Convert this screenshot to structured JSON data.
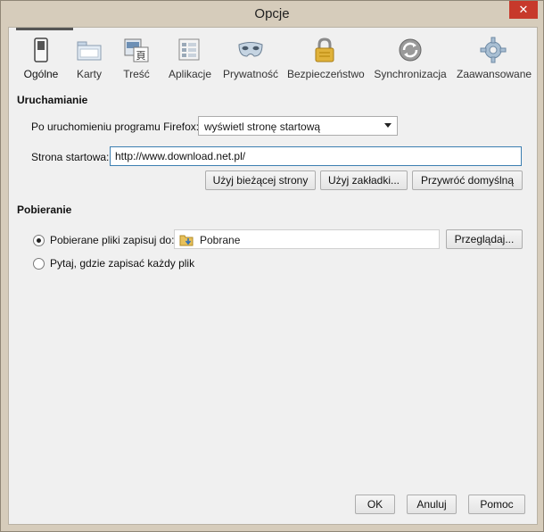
{
  "window": {
    "title": "Opcje",
    "close_glyph": "✕"
  },
  "toolbar": {
    "items": [
      {
        "label": "Ogólne",
        "icon": "general-switch-icon",
        "active": true
      },
      {
        "label": "Karty",
        "icon": "tabs-icon"
      },
      {
        "label": "Treść",
        "icon": "content-icon"
      },
      {
        "label": "Aplikacje",
        "icon": "applications-icon"
      },
      {
        "label": "Prywatność",
        "icon": "privacy-mask-icon"
      },
      {
        "label": "Bezpieczeństwo",
        "icon": "security-lock-icon"
      },
      {
        "label": "Synchronizacja",
        "icon": "sync-icon"
      },
      {
        "label": "Zaawansowane",
        "icon": "advanced-gear-icon"
      }
    ]
  },
  "startup": {
    "section_title": "Uruchamianie",
    "on_start_label": "Po uruchomieniu programu Firefox:",
    "on_start_value": "wyświetl stronę startową",
    "homepage_label": "Strona startowa:",
    "homepage_value": "http://www.download.net.pl/",
    "buttons": {
      "use_current": "Użyj bieżącej strony",
      "use_bookmark": "Użyj zakładki...",
      "restore_default": "Przywróć domyślną"
    }
  },
  "downloads": {
    "section_title": "Pobieranie",
    "save_to_label": "Pobierane pliki zapisuj do:",
    "folder_value": "Pobrane",
    "browse_button": "Przeglądaj...",
    "ask_label": "Pytaj, gdzie zapisać każdy plik",
    "selected_option": "save_to"
  },
  "footer": {
    "ok": "OK",
    "cancel": "Anuluj",
    "help": "Pomoc"
  },
  "colors": {
    "frame": "#d6ccbb",
    "client": "#f0f0f0",
    "close": "#c7392b",
    "input_focus": "#3c7fb1"
  }
}
